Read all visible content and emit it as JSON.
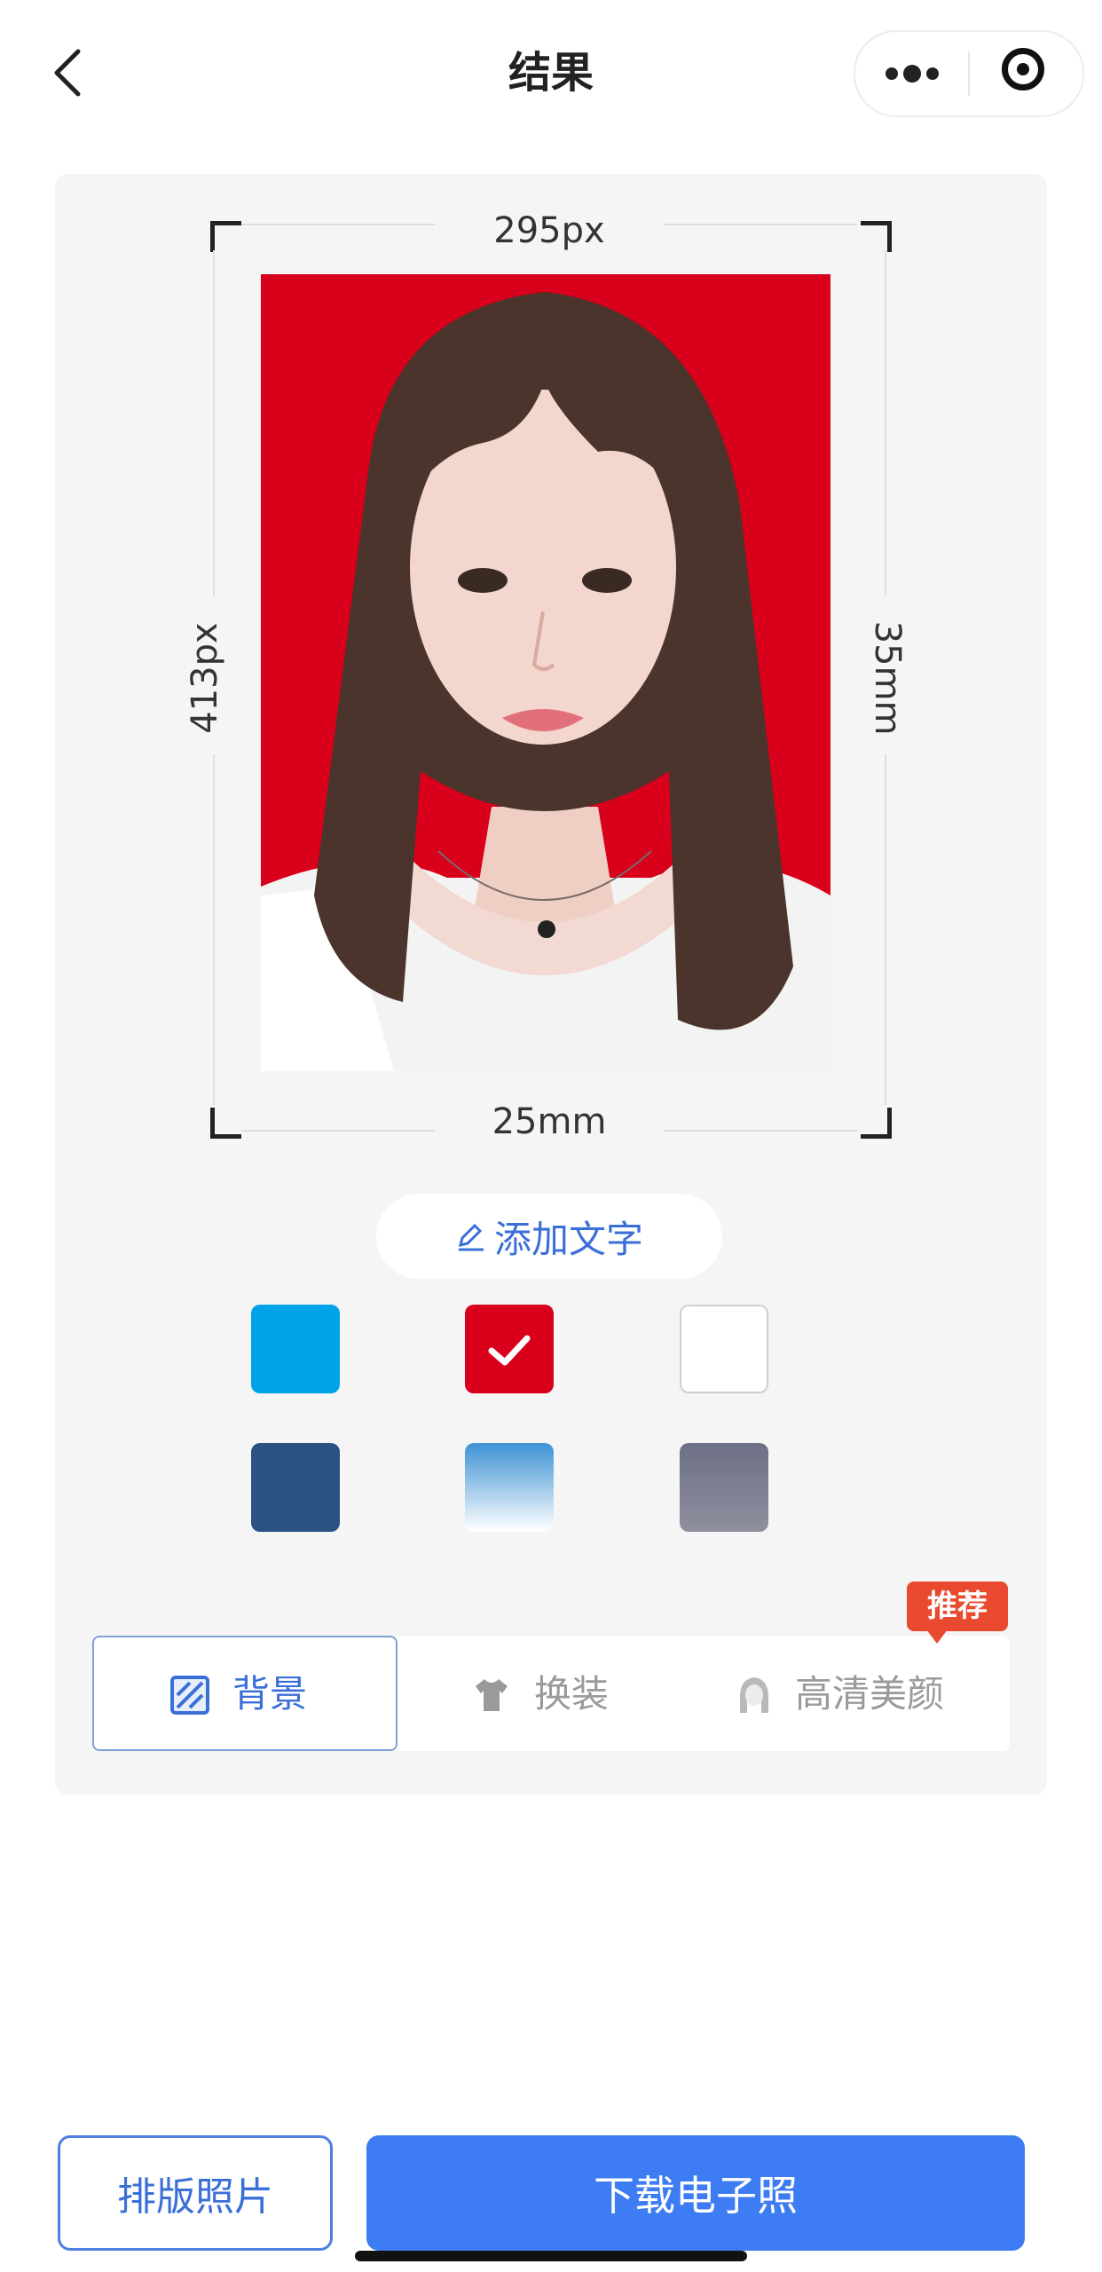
{
  "nav": {
    "title": "结果",
    "back_icon": "chevron-left-icon",
    "more_icon": "more-dots-icon",
    "close_icon": "target-circle-icon"
  },
  "preview": {
    "width_px": "295px",
    "height_px": "413px",
    "width_mm": "25mm",
    "height_mm": "35mm",
    "background_color": "#d9001b"
  },
  "add_text": {
    "label": "添加文字",
    "icon": "pencil-icon"
  },
  "colors": {
    "swatches": [
      {
        "name": "blue",
        "color": "#00a3e8",
        "selected": false
      },
      {
        "name": "red",
        "color": "#d9001b",
        "selected": true
      },
      {
        "name": "white",
        "color": "#ffffff",
        "selected": false
      },
      {
        "name": "dark-blue",
        "color": "#2b5282",
        "selected": false
      },
      {
        "name": "gradient-blue",
        "color": "#3f93d5",
        "selected": false
      },
      {
        "name": "gradient-gray",
        "color": "#6d6f85",
        "selected": false
      }
    ]
  },
  "tabs": [
    {
      "label": "背景",
      "icon": "background-icon",
      "active": true
    },
    {
      "label": "换装",
      "icon": "shirt-icon",
      "active": false
    },
    {
      "label": "高清美颜",
      "icon": "face-icon",
      "active": false
    }
  ],
  "badge": {
    "label": "推荐"
  },
  "actions": {
    "layout_label": "排版照片",
    "download_label": "下载电子照"
  },
  "theme": {
    "accent": "#3d7cf3",
    "card_bg": "#f5f5f5"
  }
}
